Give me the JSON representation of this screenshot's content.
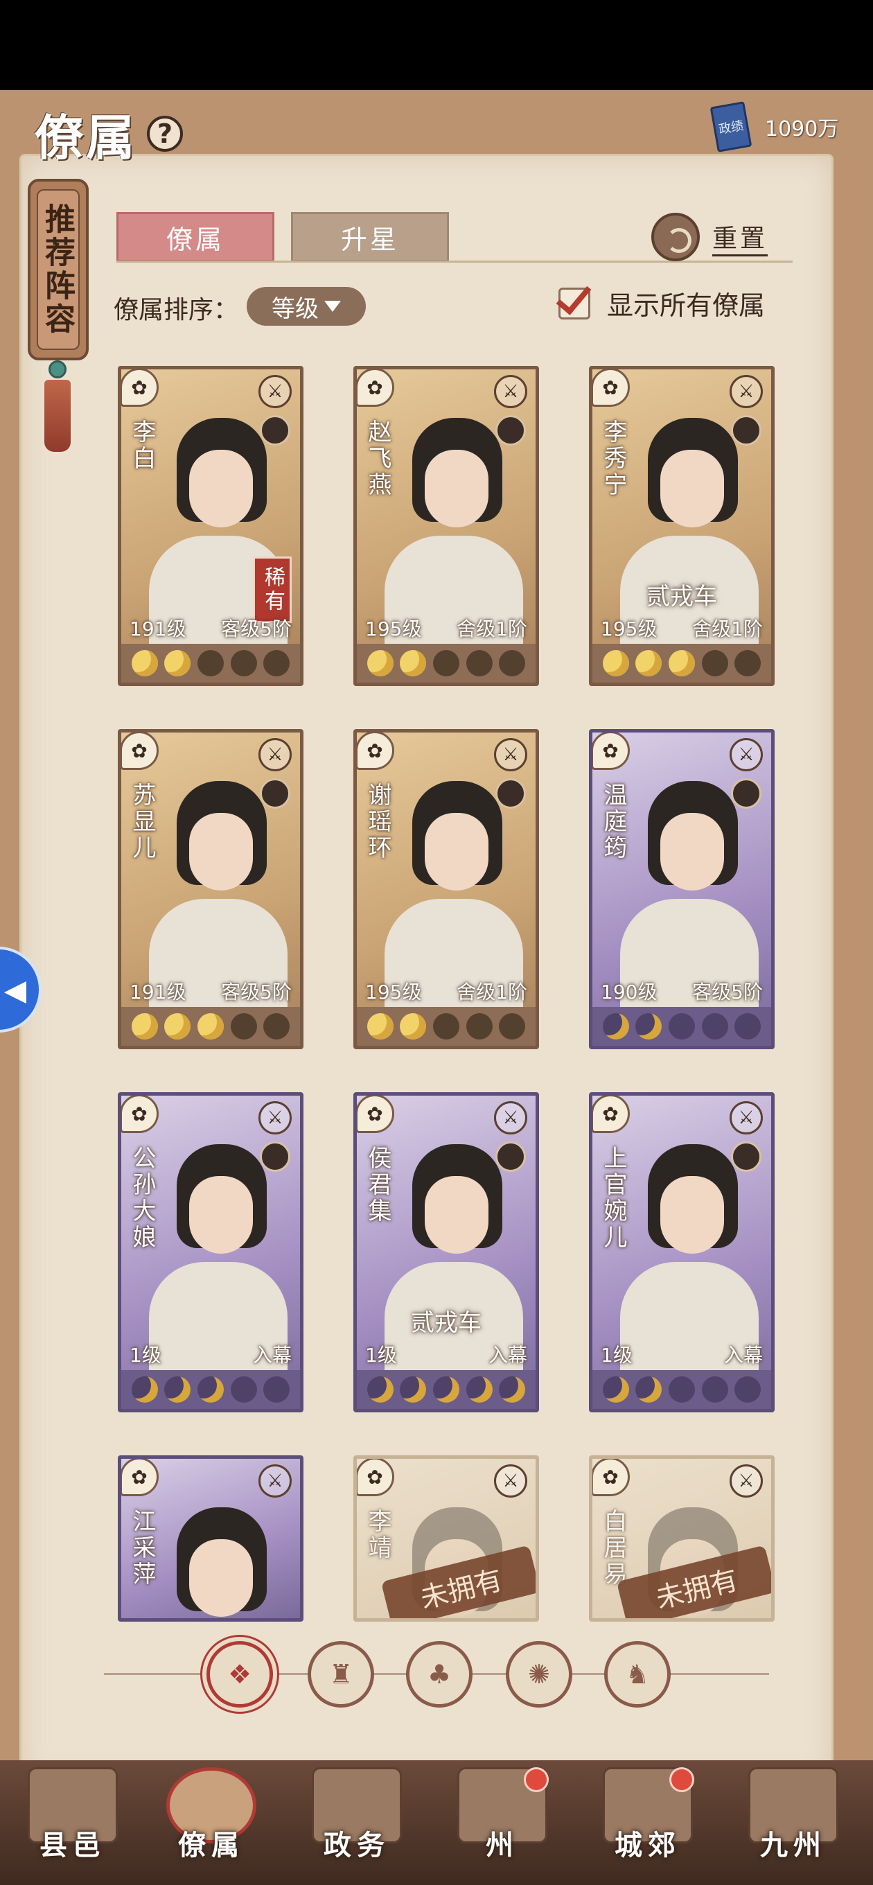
{
  "header": {
    "title": "僚属",
    "help_symbol": "?",
    "currency_icon_text": "政绩",
    "currency_value": "1090万"
  },
  "recommend": {
    "label": "推荐阵容"
  },
  "tabs": {
    "officials": "僚属",
    "star_up": "升星",
    "reset": "重置"
  },
  "sort": {
    "label": "僚属排序：",
    "value": "等级"
  },
  "show_all": {
    "label": "显示所有僚属",
    "checked": true
  },
  "cards": [
    {
      "name": "李白",
      "style": "gold",
      "level": "191级",
      "rank": "客级5阶",
      "moons": 2,
      "badge": "稀有",
      "overlay": ""
    },
    {
      "name": "赵飞燕",
      "style": "gold",
      "level": "195级",
      "rank": "舍级1阶",
      "moons": 2,
      "badge": "",
      "overlay": ""
    },
    {
      "name": "李秀宁",
      "style": "gold",
      "level": "195级",
      "rank": "舍级1阶",
      "moons": 3,
      "badge": "",
      "overlay": "贰戎车"
    },
    {
      "name": "苏显儿",
      "style": "gold",
      "level": "191级",
      "rank": "客级5阶",
      "moons": 3,
      "badge": "",
      "overlay": ""
    },
    {
      "name": "谢瑶环",
      "style": "gold",
      "level": "195级",
      "rank": "舍级1阶",
      "moons": 2,
      "badge": "",
      "overlay": ""
    },
    {
      "name": "温庭筠",
      "style": "purple",
      "level": "190级",
      "rank": "客级5阶",
      "moons": 2,
      "badge": "",
      "overlay": ""
    },
    {
      "name": "公孙大娘",
      "style": "purple",
      "level": "1级",
      "rank": "入幕",
      "moons": 3,
      "badge": "",
      "overlay": ""
    },
    {
      "name": "侯君集",
      "style": "purple",
      "level": "1级",
      "rank": "入幕",
      "moons": 5,
      "badge": "",
      "overlay": "贰戎车"
    },
    {
      "name": "上官婉儿",
      "style": "purple",
      "level": "1级",
      "rank": "入幕",
      "moons": 2,
      "badge": "",
      "overlay": ""
    },
    {
      "name": "江采萍",
      "style": "purple",
      "level": "",
      "rank": "",
      "moons": 0,
      "badge": "",
      "overlay": ""
    },
    {
      "name": "李靖",
      "style": "faded",
      "level": "",
      "rank": "",
      "moons": 0,
      "badge": "",
      "overlay": "",
      "not_owned": "未拥有"
    },
    {
      "name": "白居易",
      "style": "faded",
      "level": "",
      "rank": "",
      "moons": 0,
      "badge": "",
      "overlay": "",
      "not_owned": "未拥有"
    }
  ],
  "filters": [
    {
      "icon": "all-icon",
      "symbol": "❖"
    },
    {
      "icon": "bell-icon",
      "symbol": "♜"
    },
    {
      "icon": "gourd-icon",
      "symbol": "♣"
    },
    {
      "icon": "fan-icon",
      "symbol": "✺"
    },
    {
      "icon": "lion-icon",
      "symbol": "♞"
    }
  ],
  "bottom_nav": [
    {
      "label": "县邑",
      "dot": false
    },
    {
      "label": "僚属",
      "dot": false
    },
    {
      "label": "政务",
      "dot": false
    },
    {
      "label": "州",
      "dot": true
    },
    {
      "label": "城郊",
      "dot": true
    },
    {
      "label": "九州",
      "dot": false
    }
  ],
  "side_float_symbol": "◀"
}
